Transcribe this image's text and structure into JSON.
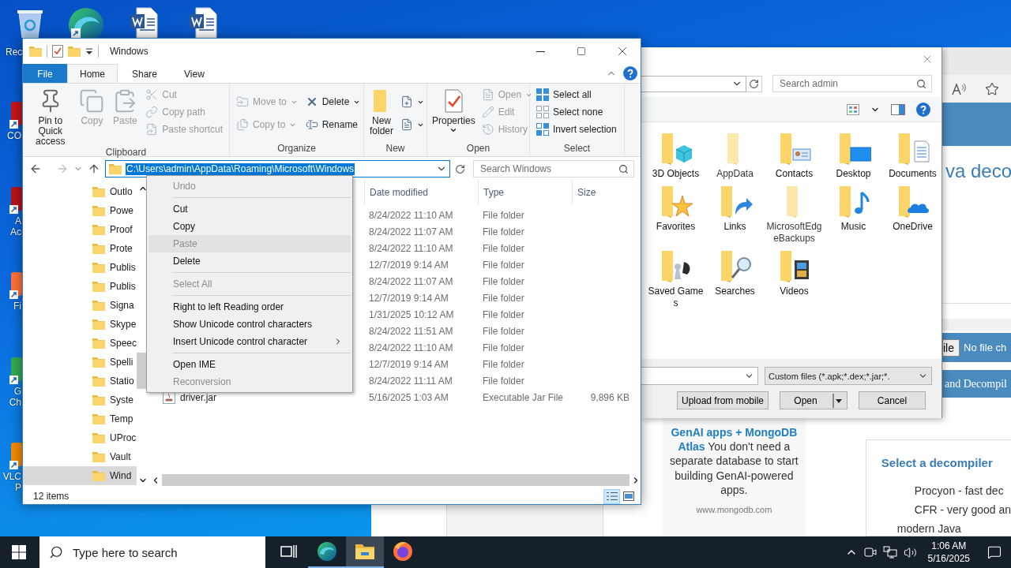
{
  "desktop": {
    "icons": [
      {
        "kind": "recycle-bin",
        "label": "Rec"
      },
      {
        "kind": "edge"
      },
      {
        "kind": "word"
      },
      {
        "kind": "word"
      }
    ],
    "side_icons": [
      {
        "color": "#c4161c",
        "lines": [
          "CO"
        ]
      },
      {
        "color": "#b5121b",
        "lines": [
          "A",
          "Ac"
        ]
      },
      {
        "color": "#ff7139",
        "lines": [
          "Fi"
        ]
      },
      {
        "color": "#34a853",
        "lines": [
          "G",
          "Ch"
        ]
      },
      {
        "color": "#f08a00",
        "lines": [
          "VLC",
          "P"
        ]
      }
    ]
  },
  "explorer": {
    "title": "Windows",
    "ribbon_tabs": [
      {
        "label": "File",
        "kind": "backstage",
        "selected": false
      },
      {
        "label": "Home",
        "kind": "tab",
        "selected": true
      },
      {
        "label": "Share",
        "kind": "tab",
        "selected": false
      },
      {
        "label": "View",
        "kind": "tab",
        "selected": false
      }
    ],
    "ribbon_groups": [
      {
        "label": "Clipboard",
        "large": [
          {
            "kind": "pin",
            "label": "Pin to Quick access",
            "disabled": false
          },
          {
            "kind": "copy",
            "label": "Copy",
            "disabled": true
          },
          {
            "kind": "paste",
            "label": "Paste",
            "disabled": true
          }
        ],
        "small": [
          [
            {
              "kind": "cut",
              "label": "Cut",
              "disabled": true
            },
            {
              "kind": "copy-path",
              "label": "Copy path",
              "disabled": true
            },
            {
              "kind": "paste-shortcut",
              "label": "Paste shortcut",
              "disabled": true
            }
          ]
        ]
      },
      {
        "label": "Organize",
        "small": [
          [
            {
              "kind": "move-to",
              "label": "Move to",
              "disabled": true,
              "dropdown": true
            },
            {
              "kind": "copy-to",
              "label": "Copy to",
              "disabled": true,
              "dropdown": true
            }
          ],
          [
            {
              "kind": "delete",
              "label": "Delete",
              "disabled": false,
              "dropdown": true
            },
            {
              "kind": "rename",
              "label": "Rename",
              "disabled": false
            }
          ]
        ]
      },
      {
        "label": "New",
        "large": [
          {
            "kind": "new-folder",
            "label": "New folder",
            "disabled": false
          }
        ],
        "small": [
          [
            {
              "kind": "new-item",
              "disabled": false,
              "dropdown": true
            },
            {
              "kind": "easy-access",
              "disabled": false,
              "dropdown": true
            }
          ]
        ]
      },
      {
        "label": "Open",
        "large": [
          {
            "kind": "properties",
            "label": "Properties",
            "disabled": false,
            "dropdown": true
          }
        ],
        "small": [
          [
            {
              "kind": "open",
              "label": "Open",
              "disabled": true,
              "dropdown": true
            },
            {
              "kind": "edit",
              "label": "Edit",
              "disabled": true
            },
            {
              "kind": "history",
              "label": "History",
              "disabled": true
            }
          ]
        ]
      },
      {
        "label": "Select",
        "small": [
          [
            {
              "kind": "select-all",
              "label": "Select all",
              "disabled": false
            },
            {
              "kind": "select-none",
              "label": "Select none",
              "disabled": false
            },
            {
              "kind": "invert-selection",
              "label": "Invert selection",
              "disabled": false
            }
          ]
        ]
      }
    ],
    "address": "C:\\Users\\admin\\AppData\\Roaming\\Microsoft\\Windows",
    "search_placeholder": "Search Windows",
    "nav_items": [
      {
        "label": "Outlo",
        "selected": false
      },
      {
        "label": "Powe",
        "selected": false
      },
      {
        "label": "Proof",
        "selected": false
      },
      {
        "label": "Prote",
        "selected": false
      },
      {
        "label": "Publis",
        "selected": false
      },
      {
        "label": "Publis",
        "selected": false
      },
      {
        "label": "Signa",
        "selected": false
      },
      {
        "label": "Skype",
        "selected": false
      },
      {
        "label": "Speec",
        "selected": false
      },
      {
        "label": "Spelli",
        "selected": false
      },
      {
        "label": "Statio",
        "selected": false
      },
      {
        "label": "Syste",
        "selected": false
      },
      {
        "label": "Temp",
        "selected": false
      },
      {
        "label": "UProc",
        "selected": false
      },
      {
        "label": "Vault",
        "selected": false
      },
      {
        "label": "Wind",
        "selected": true
      }
    ],
    "columns": [
      "Date modified",
      "Type",
      "Size"
    ],
    "rows": [
      {
        "date": "8/24/2022 11:10 AM",
        "type": "File folder"
      },
      {
        "date": "8/24/2022 11:07 AM",
        "type": "File folder"
      },
      {
        "date": "8/24/2022 11:10 AM",
        "type": "File folder"
      },
      {
        "date": "12/7/2019 9:14 AM",
        "type": "File folder"
      },
      {
        "date": "8/24/2022 11:07 AM",
        "type": "File folder"
      },
      {
        "date": "12/7/2019 9:14 AM",
        "type": "File folder"
      },
      {
        "date": "1/31/2025 10:12 AM",
        "type": "File folder"
      },
      {
        "date": "8/24/2022 11:51 AM",
        "type": "File folder"
      },
      {
        "date": "8/24/2022 11:10 AM",
        "type": "File folder"
      },
      {
        "date": "12/7/2019 9:14 AM",
        "type": "File folder"
      },
      {
        "date": "8/24/2022 11:11 AM",
        "type": "File folder"
      },
      {
        "kind": "jar",
        "name": "driver.jar",
        "date": "5/16/2025 1:03 AM",
        "type": "Executable Jar File",
        "size": "9,896 KB"
      }
    ],
    "status": "12 items",
    "view_buttons": [
      {
        "kind": "details",
        "selected": true
      },
      {
        "kind": "large-icons",
        "selected": false
      }
    ],
    "context_menu": [
      {
        "kind": "item",
        "label": "Undo",
        "disabled": true,
        "highlighted": false
      },
      {
        "kind": "separator"
      },
      {
        "kind": "item",
        "label": "Cut",
        "disabled": false,
        "highlighted": false
      },
      {
        "kind": "item",
        "label": "Copy",
        "disabled": false,
        "highlighted": false
      },
      {
        "kind": "item",
        "label": "Paste",
        "disabled": true,
        "highlighted": true
      },
      {
        "kind": "item",
        "label": "Delete",
        "disabled": false,
        "highlighted": false
      },
      {
        "kind": "separator"
      },
      {
        "kind": "item",
        "label": "Select All",
        "disabled": true,
        "highlighted": false
      },
      {
        "kind": "separator"
      },
      {
        "kind": "item",
        "label": "Right to left Reading order",
        "disabled": false,
        "highlighted": false
      },
      {
        "kind": "item",
        "label": "Show Unicode control characters",
        "disabled": false,
        "highlighted": false
      },
      {
        "kind": "item",
        "label": "Insert Unicode control character",
        "disabled": false,
        "highlighted": false,
        "submenu": true
      },
      {
        "kind": "separator"
      },
      {
        "kind": "item",
        "label": "Open IME",
        "disabled": false,
        "highlighted": false
      },
      {
        "kind": "item",
        "label": "Reconversion",
        "disabled": true,
        "highlighted": false
      }
    ]
  },
  "dialog": {
    "search_placeholder": "Search admin",
    "folders": [
      {
        "kind": "objects",
        "label": "3D Objects",
        "hidden": false
      },
      {
        "kind": "plain",
        "label": "AppData",
        "hidden": true
      },
      {
        "kind": "contacts",
        "label": "Contacts",
        "hidden": false
      },
      {
        "kind": "desktop",
        "label": "Desktop",
        "hidden": false
      },
      {
        "kind": "documents",
        "label": "Documents",
        "hidden": false
      },
      {
        "kind": "favorites",
        "label": "Favorites",
        "hidden": false
      },
      {
        "kind": "links",
        "label": "Links",
        "hidden": false
      },
      {
        "kind": "plain",
        "label": "MicrosoftEdgeBackups",
        "hidden": true
      },
      {
        "kind": "music",
        "label": "Music",
        "hidden": false
      },
      {
        "kind": "onedrive",
        "label": "OneDrive",
        "hidden": false
      },
      {
        "kind": "games",
        "label": "Saved Games",
        "hidden": false
      },
      {
        "kind": "searches",
        "label": "Searches",
        "hidden": false
      },
      {
        "kind": "videos",
        "label": "Videos",
        "hidden": false
      }
    ],
    "file_type": "Custom files (*.apk;*.dex;*.jar;*.",
    "buttons": [
      {
        "kind": "button",
        "label": "Upload from mobile"
      },
      {
        "kind": "split",
        "label": "Open"
      },
      {
        "kind": "button",
        "label": "Cancel"
      }
    ]
  },
  "browser": {
    "heading": "va deco",
    "file_button": "ile",
    "file_status": "No file ch",
    "banner": "and Decompil",
    "ad": {
      "text": "**GenAI apps + MongoDB Atlas** You don't need a separate database to start building GenAI-powered apps.",
      "url": "www.mongodb.com"
    },
    "decompiler": {
      "title": "Select a decompiler",
      "options": [
        {
          "lines": [
            "Procyon - fast dec"
          ]
        },
        {
          "lines": [
            "CFR - very good an",
            "modern Java"
          ]
        }
      ]
    }
  },
  "taskbar": {
    "search_placeholder": "Type here to search",
    "apps": [
      {
        "kind": "task-view",
        "running": false,
        "active": false
      },
      {
        "kind": "edge",
        "running": true,
        "active": false
      },
      {
        "kind": "explorer",
        "running": true,
        "active": true
      },
      {
        "kind": "firefox",
        "running": false,
        "active": false
      }
    ],
    "time": "1:06 AM",
    "date": "5/16/2025"
  }
}
